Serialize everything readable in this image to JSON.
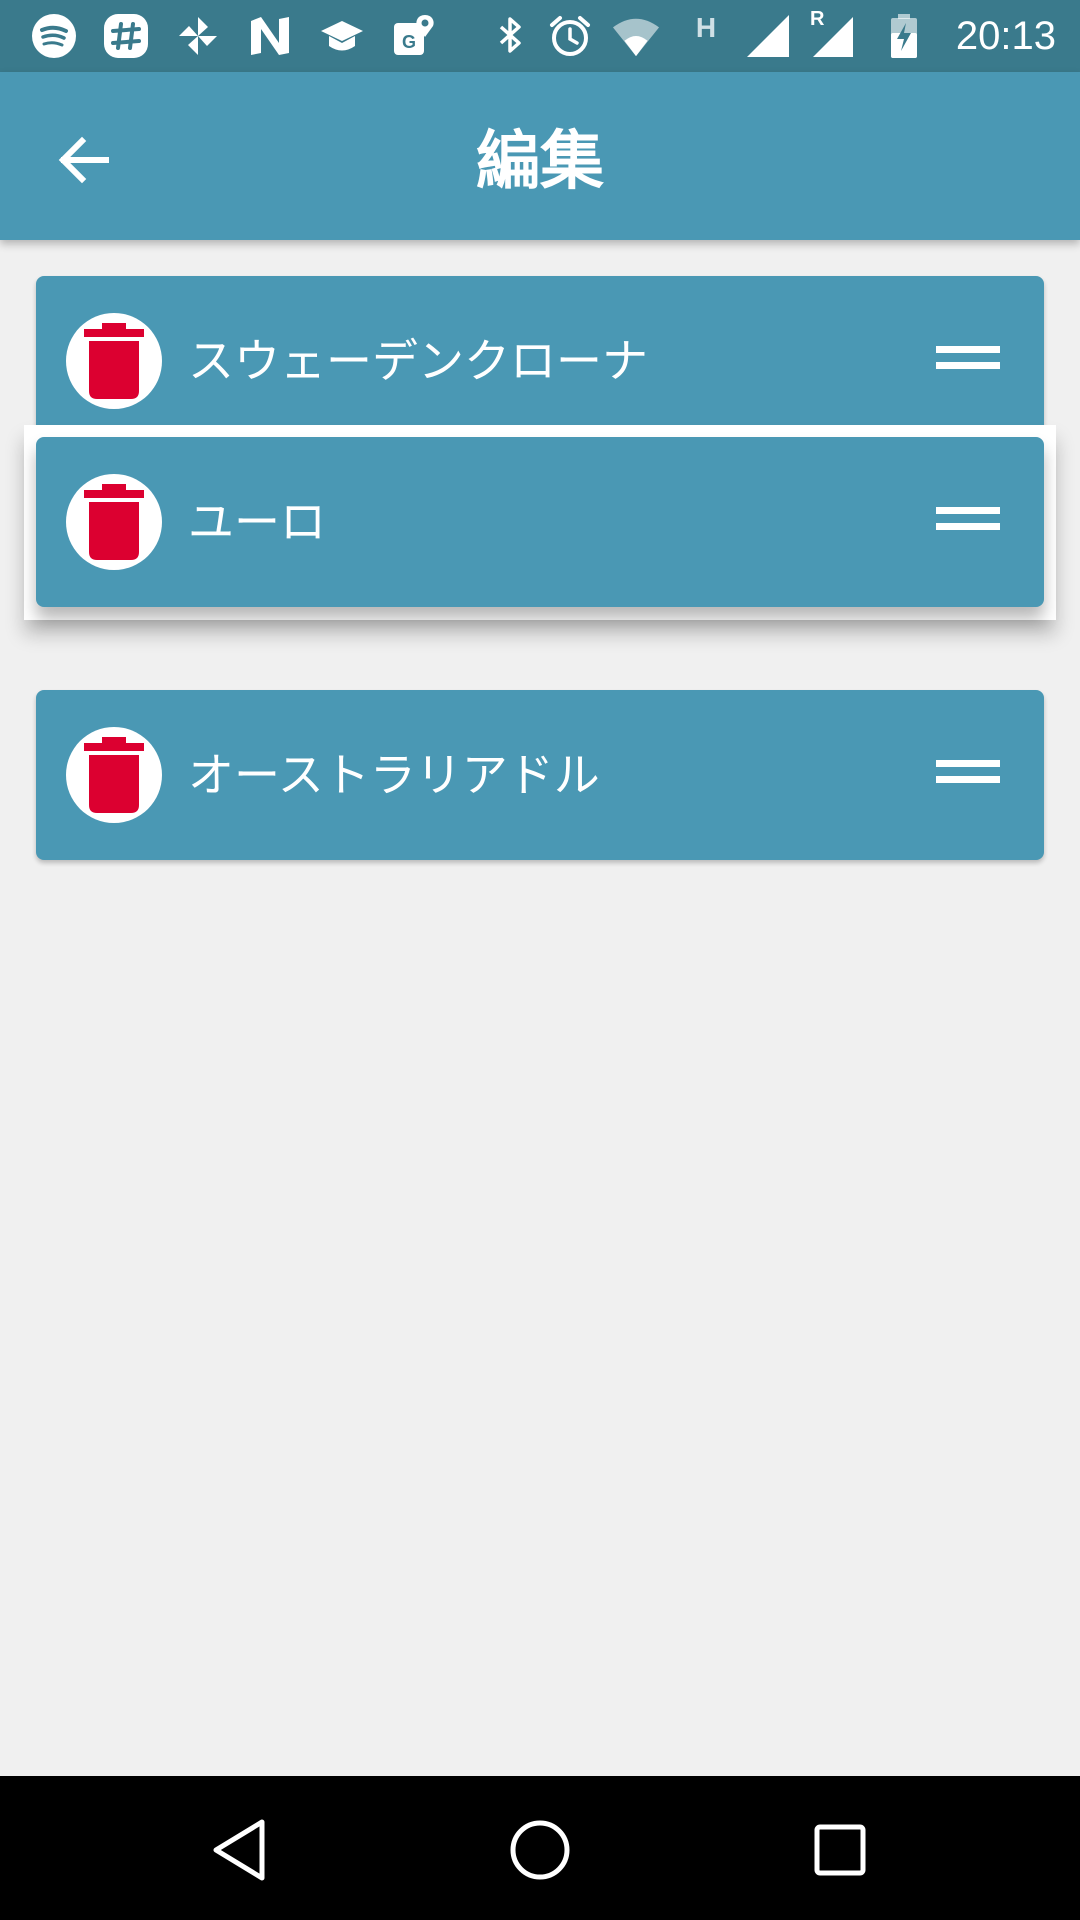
{
  "status_bar": {
    "time": "20:13",
    "icons": [
      "spotify-icon",
      "slack-icon",
      "pinwheel-icon",
      "n-app-icon",
      "graduation-cap-icon",
      "maps-icon",
      "bluetooth-icon",
      "alarm-icon",
      "wifi-icon",
      "h-network-icon",
      "signal-icon",
      "roaming-signal-icon",
      "battery-charging-icon"
    ],
    "network_type": "H",
    "roaming_label": "R"
  },
  "app_bar": {
    "title": "編集",
    "back_icon": "arrow-back-icon"
  },
  "list": {
    "items": [
      {
        "label": "スウェーデンクローナ",
        "delete_icon": "trash-icon",
        "handle_icon": "drag-handle-icon"
      },
      {
        "label": "ユーロ",
        "delete_icon": "trash-icon",
        "handle_icon": "drag-handle-icon",
        "state": "dragging"
      },
      {
        "label": "オーストラリアドル",
        "delete_icon": "trash-icon",
        "handle_icon": "drag-handle-icon"
      }
    ]
  },
  "nav_bar": {
    "buttons": [
      "back-triangle-icon",
      "home-circle-icon",
      "recents-square-icon"
    ]
  },
  "colors": {
    "status_bar": "#3a7a8c",
    "accent": "#4a98b4",
    "delete_red": "#dc0030",
    "background": "#f0f0f0"
  }
}
